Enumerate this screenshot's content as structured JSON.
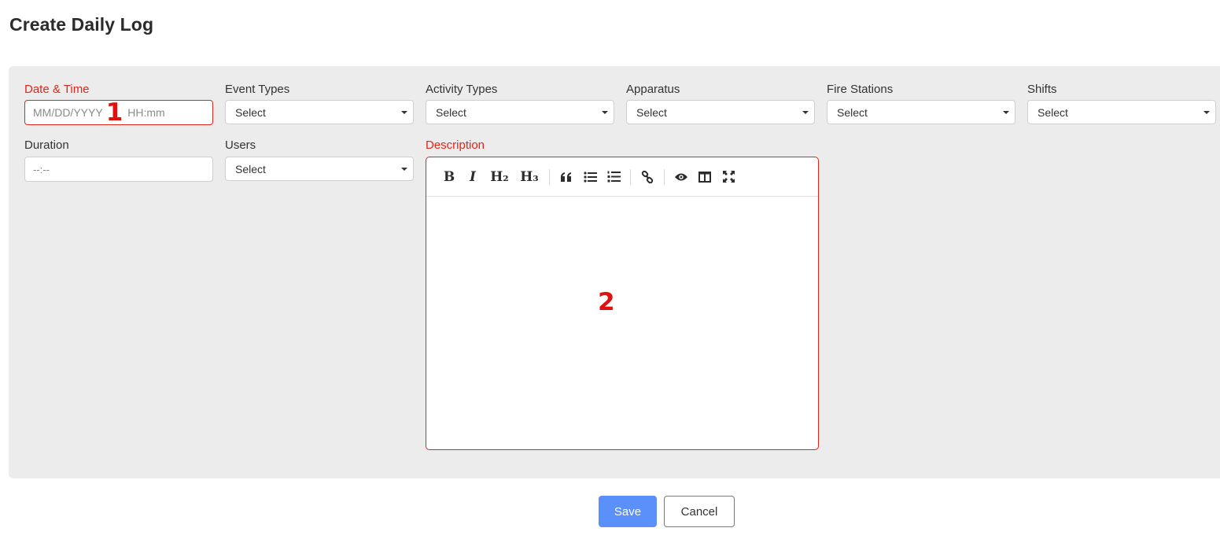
{
  "page": {
    "title": "Create Daily Log"
  },
  "form": {
    "date_time": {
      "label": "Date & Time",
      "date_placeholder": "MM/DD/YYYY",
      "time_placeholder": "HH:mm",
      "marker": "1"
    },
    "event_types": {
      "label": "Event Types",
      "value": "Select"
    },
    "activity_types": {
      "label": "Activity Types",
      "value": "Select"
    },
    "apparatus": {
      "label": "Apparatus",
      "value": "Select"
    },
    "fire_stations": {
      "label": "Fire Stations",
      "value": "Select"
    },
    "shifts": {
      "label": "Shifts",
      "value": "Select"
    },
    "duration": {
      "label": "Duration",
      "placeholder": "--:--"
    },
    "users": {
      "label": "Users",
      "value": "Select"
    },
    "description": {
      "label": "Description",
      "marker": "2",
      "toolbar": {
        "bold": "B",
        "italic": "I",
        "heading2": "H₂",
        "heading3": "H₃"
      }
    }
  },
  "actions": {
    "save_label": "Save",
    "cancel_label": "Cancel"
  },
  "colors": {
    "required": "#e0261a",
    "primary": "#5b8ff9",
    "panel": "#ececec",
    "marker": "#e0110f"
  },
  "icons": [
    "bold-icon",
    "italic-icon",
    "heading2-icon",
    "heading3-icon",
    "quote-icon",
    "unordered-list-icon",
    "ordered-list-icon",
    "link-icon",
    "preview-icon",
    "side-by-side-icon",
    "fullscreen-icon"
  ]
}
